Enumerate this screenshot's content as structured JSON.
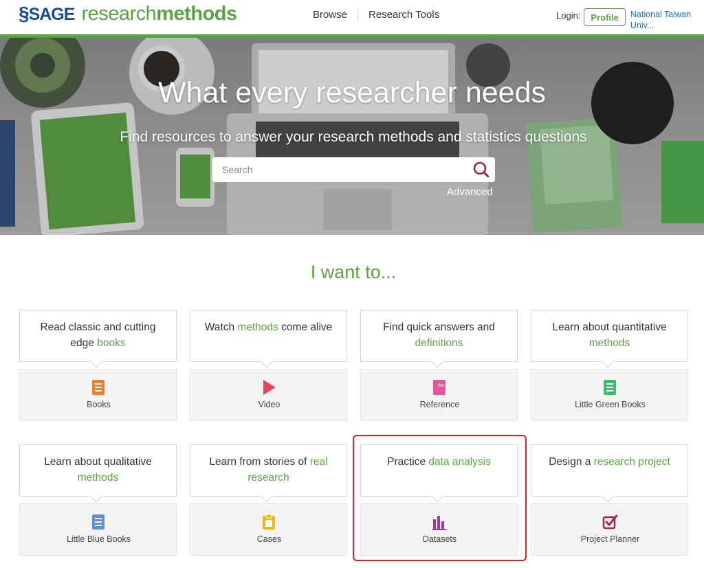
{
  "header": {
    "logo_sage": "SAGE",
    "logo_research": "research",
    "logo_methods": "methods",
    "nav": [
      {
        "label": "Browse"
      },
      {
        "label": "Research Tools"
      }
    ],
    "login_label": "Login:",
    "profile_label": "Profile",
    "institution_line1": "National Taiwan",
    "institution_line2": "Univ..."
  },
  "hero": {
    "title": "What every researcher needs",
    "subtitle": "Find resources to answer your research methods and statistics questions",
    "search_placeholder": "Search",
    "advanced_label": "Advanced"
  },
  "want": {
    "title": "I want to...",
    "cards": [
      {
        "pre": "Read classic and cutting edge ",
        "hl": "books",
        "post": "",
        "label": "Books",
        "icon": "book-icon",
        "color": "#f07f2a"
      },
      {
        "pre": "Watch ",
        "hl": "methods",
        "post": " come alive",
        "label": "Video",
        "icon": "play-icon",
        "color": "#e8435a"
      },
      {
        "pre": "Find quick answers and ",
        "hl": "definitions",
        "post": "",
        "label": "Reference",
        "icon": "reference-icon",
        "color": "#e2579a"
      },
      {
        "pre": "Learn about quantitative ",
        "hl": "methods",
        "post": "",
        "label": "Little Green Books",
        "icon": "green-book-icon",
        "color": "#3dbb6e"
      },
      {
        "pre": "Learn about qualitative ",
        "hl": "methods",
        "post": "",
        "label": "Little Blue Books",
        "icon": "blue-book-icon",
        "color": "#5b8fd6"
      },
      {
        "pre": "Learn from stories of ",
        "hl": "real research",
        "post": "",
        "label": "Cases",
        "icon": "clipboard-icon",
        "color": "#f2b31b"
      },
      {
        "pre": "Practice ",
        "hl": "data analysis",
        "post": "",
        "label": "Datasets",
        "icon": "bar-chart-icon",
        "color": "#9b3d9c"
      },
      {
        "pre": "Design a ",
        "hl": "research project",
        "post": "",
        "label": "Project Planner",
        "icon": "checkbox-icon",
        "color": "#a0224e"
      }
    ]
  },
  "colors": {
    "brand_green": "#5aa244",
    "sage_blue": "#1a4d8f",
    "link_blue": "#1e6fa8",
    "highlight_red": "#e0201f",
    "search_icon": "#a0224e"
  }
}
